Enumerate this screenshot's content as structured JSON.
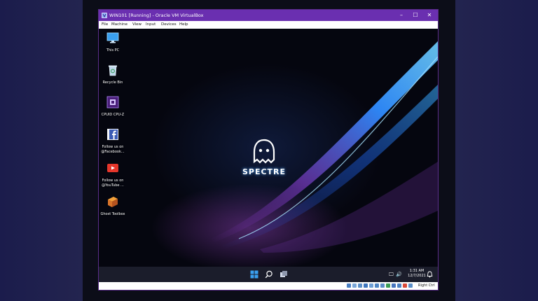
{
  "window": {
    "title": "WIN101 [Running] - Oracle VM VirtualBox",
    "controls": {
      "minimize": "–",
      "maximize": "☐",
      "close": "✕"
    }
  },
  "menu": [
    "File",
    "Machine",
    "View",
    "Input",
    "Devices",
    "Help"
  ],
  "desktop": {
    "icons": [
      {
        "label": "This PC",
        "icon": "monitor-icon"
      },
      {
        "label": "Recycle Bin",
        "icon": "recycle-bin-icon"
      },
      {
        "label": "CPUID CPU-Z",
        "icon": "cpuz-icon"
      },
      {
        "label": "Follow us on @Facebook...",
        "icon": "facebook-icon"
      },
      {
        "label": "Follow us on @YouTube ...",
        "icon": "youtube-icon"
      },
      {
        "label": "Ghost Toolbox",
        "icon": "toolbox-icon"
      }
    ],
    "logo_text": "SPECTRE"
  },
  "taskbar": {
    "clock_time": "1:31 AM",
    "clock_date": "12/7/2021",
    "tray": {
      "network": "🖵",
      "volume": "🔊"
    }
  },
  "statusbar": {
    "host_key": "Right Ctrl"
  },
  "colors": {
    "titlebar": "#6a2fb0",
    "backdrop": "#1c1d4a",
    "taskbar": "#1b1d2b",
    "accent_blue": "#2f8cff"
  }
}
